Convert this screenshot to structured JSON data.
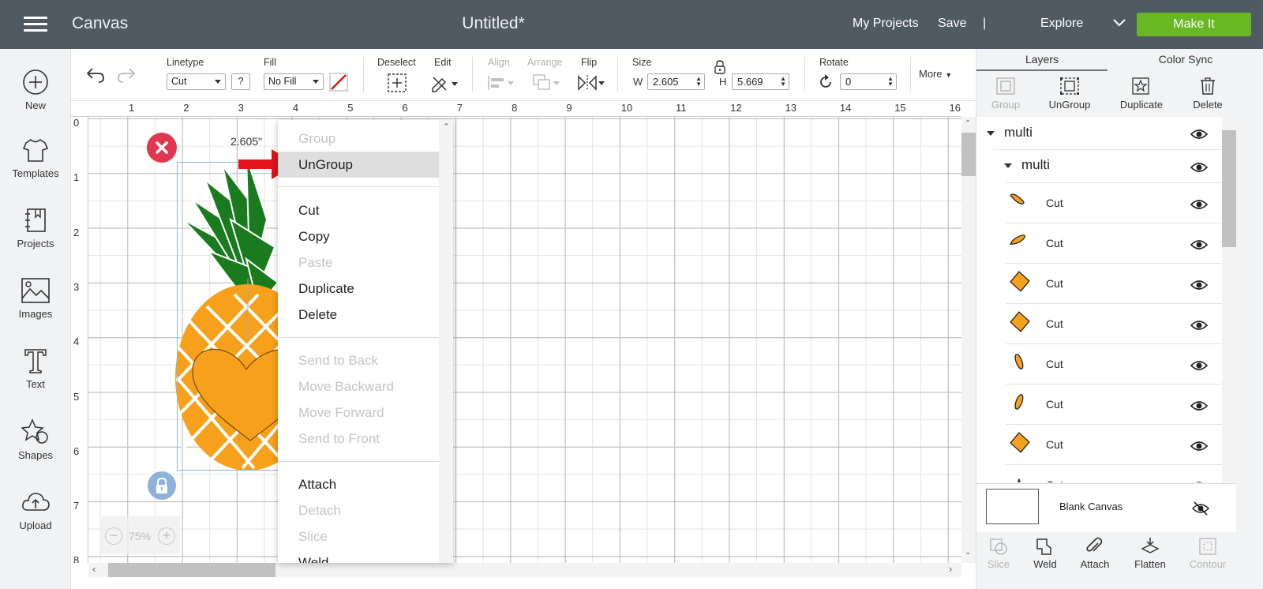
{
  "header": {
    "menu_icon": "hamburger-icon",
    "app_title": "Canvas",
    "doc_title": "Untitled*",
    "my_projects": "My Projects",
    "save": "Save",
    "separator": "|",
    "explore": "Explore",
    "make_it": "Make It",
    "colors": {
      "bar": "#505a63",
      "make_it": "#68b823"
    }
  },
  "sidebar": {
    "items": [
      {
        "label": "New",
        "icon": "plus-circle-icon"
      },
      {
        "label": "Templates",
        "icon": "tshirt-icon"
      },
      {
        "label": "Projects",
        "icon": "notebook-icon"
      },
      {
        "label": "Images",
        "icon": "image-icon"
      },
      {
        "label": "Text",
        "icon": "text-icon"
      },
      {
        "label": "Shapes",
        "icon": "shapes-icon"
      },
      {
        "label": "Upload",
        "icon": "cloud-upload-icon"
      }
    ]
  },
  "toolbar": {
    "linetype_label": "Linetype",
    "linetype_value": "Cut",
    "help": "?",
    "fill_label": "Fill",
    "fill_value": "No Fill",
    "deselect": "Deselect",
    "edit": "Edit",
    "align": "Align",
    "arrange": "Arrange",
    "flip": "Flip",
    "size": "Size",
    "w_label": "W",
    "w_value": "2.605",
    "h_label": "H",
    "h_value": "5.669",
    "rotate": "Rotate",
    "rotate_value": "0",
    "more": "More"
  },
  "ruler": {
    "top": [
      "1",
      "2",
      "3",
      "4",
      "5",
      "6",
      "7",
      "8",
      "9",
      "10",
      "11",
      "12",
      "13",
      "14",
      "15",
      "16"
    ],
    "left": [
      "0",
      "1",
      "2",
      "3",
      "4",
      "5",
      "6",
      "7",
      "8"
    ]
  },
  "canvas": {
    "dimension_label": "2.605\"",
    "zoom_minus": "−",
    "zoom_level": "75%",
    "zoom_plus": "+",
    "colors": {
      "leaves": "#1a7a1e",
      "body": "#f7a01b"
    }
  },
  "context_menu": {
    "items": [
      {
        "label": "Group",
        "enabled": false
      },
      {
        "label": "UnGroup",
        "enabled": true,
        "highlighted": true
      },
      {
        "label": "Cut",
        "enabled": true
      },
      {
        "label": "Copy",
        "enabled": true
      },
      {
        "label": "Paste",
        "enabled": false
      },
      {
        "label": "Duplicate",
        "enabled": true
      },
      {
        "label": "Delete",
        "enabled": true
      },
      {
        "label": "Send to Back",
        "enabled": false
      },
      {
        "label": "Move Backward",
        "enabled": false
      },
      {
        "label": "Move Forward",
        "enabled": false
      },
      {
        "label": "Send to Front",
        "enabled": false
      },
      {
        "label": "Attach",
        "enabled": true
      },
      {
        "label": "Detach",
        "enabled": false
      },
      {
        "label": "Slice",
        "enabled": false
      },
      {
        "label": "Weld",
        "enabled": true
      }
    ]
  },
  "right_panel": {
    "tabs": [
      "Layers",
      "Color Sync"
    ],
    "tools": [
      {
        "label": "Group",
        "enabled": false,
        "icon": "group-icon"
      },
      {
        "label": "UnGroup",
        "enabled": true,
        "icon": "ungroup-icon"
      },
      {
        "label": "Duplicate",
        "enabled": true,
        "icon": "duplicate-icon"
      },
      {
        "label": "Delete",
        "enabled": true,
        "icon": "trash-icon"
      }
    ],
    "groups": [
      "multi",
      "multi"
    ],
    "layers": [
      "Cut",
      "Cut",
      "Cut",
      "Cut",
      "Cut",
      "Cut",
      "Cut",
      "Cut"
    ],
    "blank_canvas": "Blank Canvas",
    "bottom_tools": [
      {
        "label": "Slice",
        "enabled": false,
        "icon": "slice-icon"
      },
      {
        "label": "Weld",
        "enabled": true,
        "icon": "weld-icon"
      },
      {
        "label": "Attach",
        "enabled": true,
        "icon": "paperclip-icon"
      },
      {
        "label": "Flatten",
        "enabled": true,
        "icon": "flatten-icon"
      },
      {
        "label": "Contour",
        "enabled": false,
        "icon": "contour-icon"
      }
    ]
  }
}
